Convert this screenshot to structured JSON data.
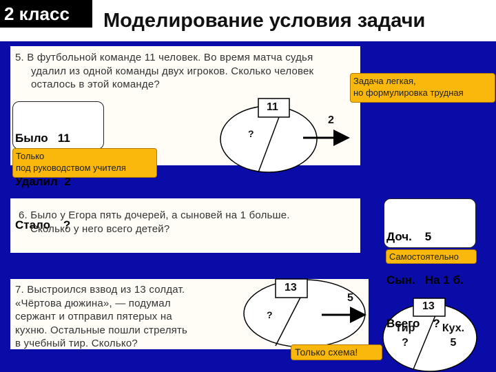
{
  "header": {
    "grade": "2 класс",
    "title": "Моделирование условия задачи"
  },
  "task5": {
    "lines": [
      "5. В футбольной команде 11 человек. Во время матча судья",
      "удалил из одной команды двух игроков. Сколько человек",
      "осталось в этой команде?"
    ],
    "note": [
      "Было   11",
      "Удалил  2",
      "Стало    ?"
    ],
    "callout_teacher": [
      "Только",
      "под руководством учителя"
    ],
    "callout_hard": [
      "Задача легкая,",
      "но формулировка трудная"
    ],
    "diagram": {
      "total": "11",
      "unknown": "?",
      "removed": "2"
    }
  },
  "task6": {
    "lines": [
      "6. Было у Егора пять дочерей, а сыновей на 1 больше.",
      "Сколько у него всего детей?"
    ],
    "note": [
      "Доч.    5",
      "Сын.   На 1 б.",
      "Всего    ?"
    ],
    "callout": "Самостоятельно"
  },
  "task7": {
    "lines": [
      "7. Выстроился взвод из 13 солдат.",
      "«Чёртова дюжина», — подумал",
      "сержант и отправил пятерых на",
      "кухню. Остальные пошли стрелять",
      "в учебный тир. Сколько?"
    ],
    "diagram": {
      "total": "13",
      "unknown": "?",
      "removed": "5"
    },
    "callout": "Только схема!",
    "diagram2": {
      "total": "13",
      "left_label": "Тир",
      "left_value": "?",
      "right_label": "Кух.",
      "right_value": "5"
    }
  }
}
